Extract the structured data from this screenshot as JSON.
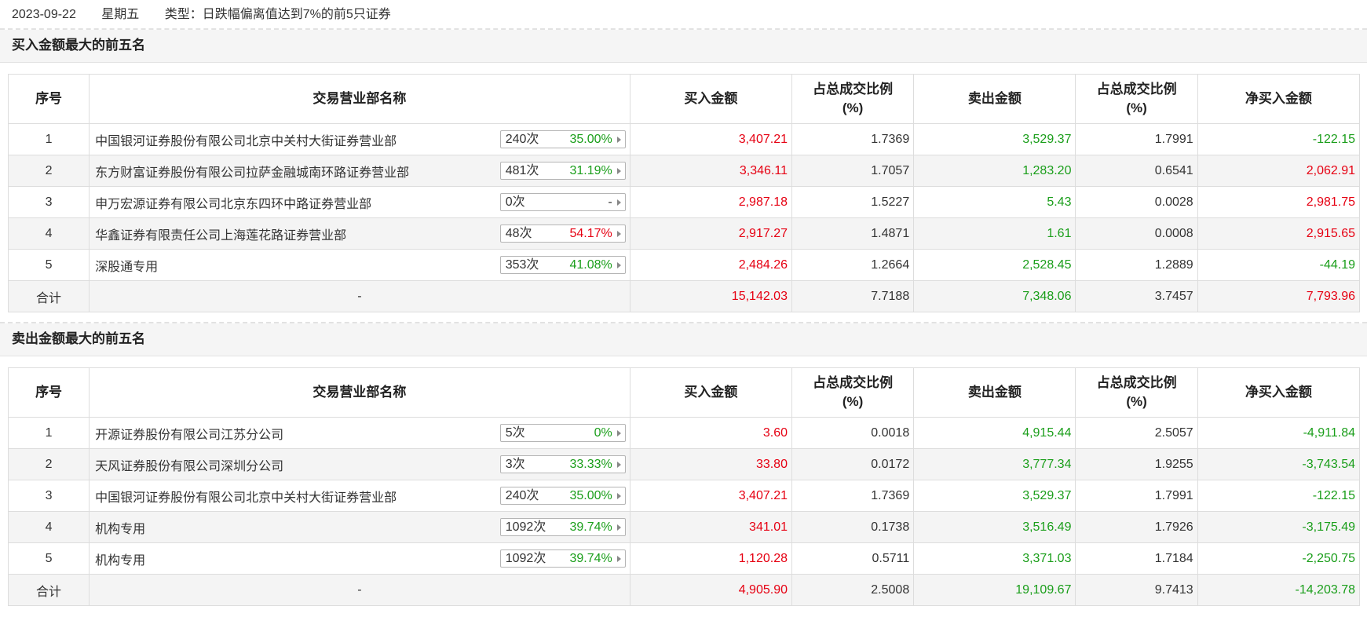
{
  "header": {
    "date": "2023-09-22",
    "weekday": "星期五",
    "type": "类型：日跌幅偏离值达到7%的前5只证券"
  },
  "columns": [
    "序号",
    "交易营业部名称",
    "买入金额",
    "占总成交比例\n(%)",
    "卖出金额",
    "占总成交比例\n(%)",
    "净买入金额"
  ],
  "colors": {
    "buy": "#e60012",
    "sell": "#1a9e1a",
    "positive": "#e60012",
    "negative": "#1a9e1a"
  },
  "buy_section": {
    "title": "买入金额最大的前五名",
    "rows": [
      {
        "rank": "1",
        "name": "中国银河证券股份有限公司北京中关村大街证券营业部",
        "count": "240次",
        "pct": "35.00%",
        "pct_color": "green",
        "buy": "3,407.21",
        "buy_ratio": "1.7369",
        "sell": "3,529.37",
        "sell_ratio": "1.7991",
        "net": "-122.15",
        "net_color": "green"
      },
      {
        "rank": "2",
        "name": "东方财富证券股份有限公司拉萨金融城南环路证券营业部",
        "count": "481次",
        "pct": "31.19%",
        "pct_color": "green",
        "buy": "3,346.11",
        "buy_ratio": "1.7057",
        "sell": "1,283.20",
        "sell_ratio": "0.6541",
        "net": "2,062.91",
        "net_color": "red"
      },
      {
        "rank": "3",
        "name": "申万宏源证券有限公司北京东四环中路证券营业部",
        "count": "0次",
        "pct": "-",
        "pct_color": "black",
        "buy": "2,987.18",
        "buy_ratio": "1.5227",
        "sell": "5.43",
        "sell_ratio": "0.0028",
        "net": "2,981.75",
        "net_color": "red"
      },
      {
        "rank": "4",
        "name": "华鑫证券有限责任公司上海莲花路证券营业部",
        "count": "48次",
        "pct": "54.17%",
        "pct_color": "red",
        "buy": "2,917.27",
        "buy_ratio": "1.4871",
        "sell": "1.61",
        "sell_ratio": "0.0008",
        "net": "2,915.65",
        "net_color": "red"
      },
      {
        "rank": "5",
        "name": "深股通专用",
        "count": "353次",
        "pct": "41.08%",
        "pct_color": "green",
        "buy": "2,484.26",
        "buy_ratio": "1.2664",
        "sell": "2,528.45",
        "sell_ratio": "1.2889",
        "net": "-44.19",
        "net_color": "green"
      }
    ],
    "total": {
      "label": "合计",
      "name": "-",
      "buy": "15,142.03",
      "buy_ratio": "7.7188",
      "sell": "7,348.06",
      "sell_ratio": "3.7457",
      "net": "7,793.96",
      "net_color": "red"
    }
  },
  "sell_section": {
    "title": "卖出金额最大的前五名",
    "rows": [
      {
        "rank": "1",
        "name": "开源证券股份有限公司江苏分公司",
        "count": "5次",
        "pct": "0%",
        "pct_color": "green",
        "buy": "3.60",
        "buy_ratio": "0.0018",
        "sell": "4,915.44",
        "sell_ratio": "2.5057",
        "net": "-4,911.84",
        "net_color": "green"
      },
      {
        "rank": "2",
        "name": "天风证券股份有限公司深圳分公司",
        "count": "3次",
        "pct": "33.33%",
        "pct_color": "green",
        "buy": "33.80",
        "buy_ratio": "0.0172",
        "sell": "3,777.34",
        "sell_ratio": "1.9255",
        "net": "-3,743.54",
        "net_color": "green"
      },
      {
        "rank": "3",
        "name": "中国银河证券股份有限公司北京中关村大街证券营业部",
        "count": "240次",
        "pct": "35.00%",
        "pct_color": "green",
        "buy": "3,407.21",
        "buy_ratio": "1.7369",
        "sell": "3,529.37",
        "sell_ratio": "1.7991",
        "net": "-122.15",
        "net_color": "green"
      },
      {
        "rank": "4",
        "name": "机构专用",
        "count": "1092次",
        "pct": "39.74%",
        "pct_color": "green",
        "buy": "341.01",
        "buy_ratio": "0.1738",
        "sell": "3,516.49",
        "sell_ratio": "1.7926",
        "net": "-3,175.49",
        "net_color": "green"
      },
      {
        "rank": "5",
        "name": "机构专用",
        "count": "1092次",
        "pct": "39.74%",
        "pct_color": "green",
        "buy": "1,120.28",
        "buy_ratio": "0.5711",
        "sell": "3,371.03",
        "sell_ratio": "1.7184",
        "net": "-2,250.75",
        "net_color": "green"
      }
    ],
    "total": {
      "label": "合计",
      "name": "-",
      "buy": "4,905.90",
      "buy_ratio": "2.5008",
      "sell": "19,109.67",
      "sell_ratio": "9.7413",
      "net": "-14,203.78",
      "net_color": "green"
    }
  }
}
